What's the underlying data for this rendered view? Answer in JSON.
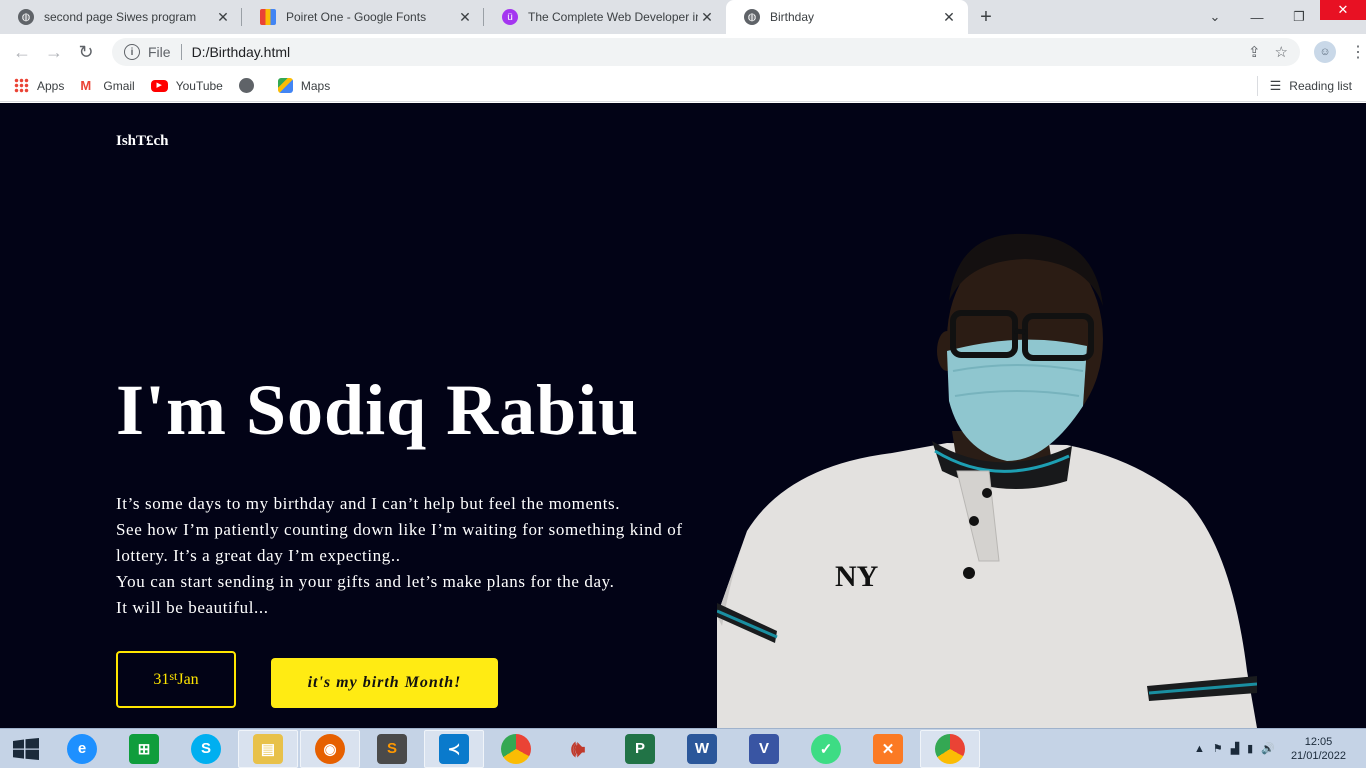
{
  "tabs": [
    {
      "title": "second page Siwes program",
      "icon": "globe-icon"
    },
    {
      "title": "Poiret One - Google Fonts",
      "icon": "google-fonts-icon"
    },
    {
      "title": "The Complete Web Developer in",
      "icon": "udemy-icon"
    },
    {
      "title": "Birthday",
      "icon": "globe-icon",
      "active": true
    }
  ],
  "toolbar": {
    "scheme": "File",
    "url": "D:/Birthday.html"
  },
  "bookmarks": [
    {
      "label": "Apps",
      "icon": "apps-grid-icon"
    },
    {
      "label": "Gmail",
      "icon": "gmail-icon"
    },
    {
      "label": "YouTube",
      "icon": "youtube-icon"
    },
    {
      "label": "",
      "icon": "globe-icon"
    },
    {
      "label": "Maps",
      "icon": "maps-icon"
    }
  ],
  "reading_list": "Reading list",
  "page": {
    "brand": "IshT£ch",
    "heading": "I'm Sodiq Rabiu",
    "paragraph": [
      "It’s some days to my birthday and I can’t help but feel the moments.",
      "See how I’m patiently counting down like I’m waiting for something kind of lottery. It’s a great day I’m expecting..",
      "You can start sending in your gifts and let’s make plans for the day.",
      "It will be beautiful..."
    ],
    "date_day": "31",
    "date_suffix": "st",
    "date_month": "Jan",
    "month_button": "it's my birth Month!",
    "accent": "#ffeb13",
    "background": "#020316"
  },
  "taskbar": {
    "apps": [
      "internet-explorer-icon",
      "store-icon",
      "skype-icon",
      "file-explorer-icon",
      "firefox-icon",
      "sublime-text-icon",
      "vscode-icon",
      "chrome-icon",
      "volume-app-icon",
      "project-icon",
      "word-icon",
      "visio-icon",
      "android-studio-icon",
      "xampp-icon",
      "chrome-active-icon"
    ],
    "time": "12:05",
    "date": "21/01/2022"
  }
}
